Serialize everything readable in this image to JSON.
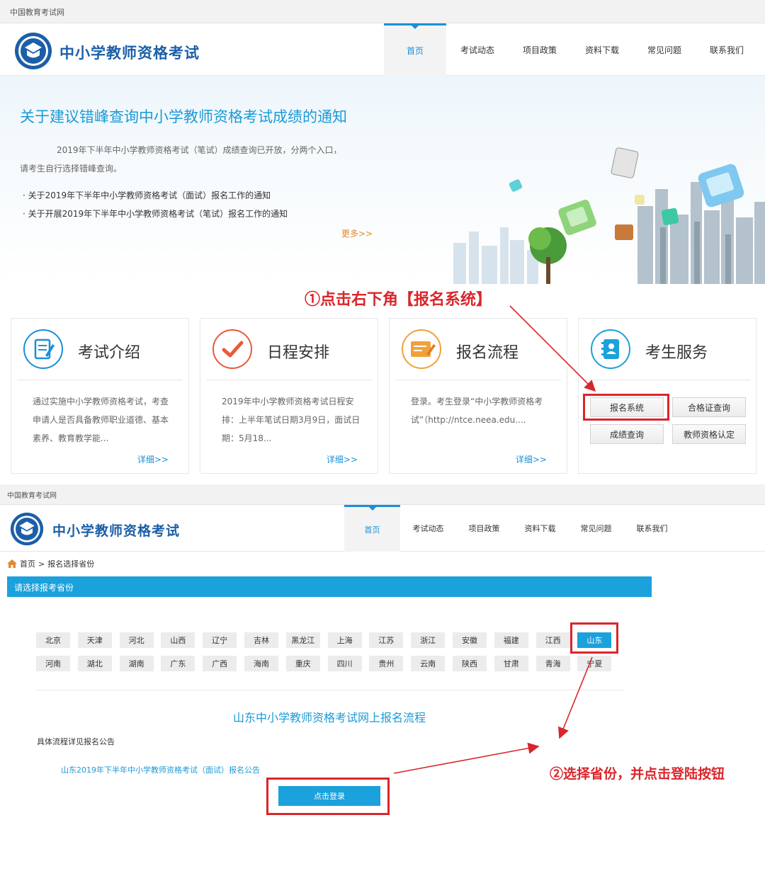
{
  "top": {
    "topbar_text": "中国教育考试网",
    "site_title": "中小学教师资格考试",
    "nav": [
      "首页",
      "考试动态",
      "项目政策",
      "资料下载",
      "常见问题",
      "联系我们"
    ],
    "banner": {
      "title": "关于建议错峰查询中小学教师资格考试成绩的通知",
      "para1": "2019年下半年中小学教师资格考试（笔试）成绩查询已开放，分两个入口，",
      "para2": "请考生自行选择错峰查询。",
      "links": [
        "关于2019年下半年中小学教师资格考试（面试）报名工作的通知",
        "关于开展2019年下半年中小学教师资格考试（笔试）报名工作的通知"
      ],
      "more": "更多>>"
    },
    "annotation": "①点击右下角【报名系统】",
    "cards": [
      {
        "title": "考试介绍",
        "body": "通过实施中小学教师资格考试，考查申请人是否具备教师职业道德、基本素养、教育教学能...",
        "more": "详细>>"
      },
      {
        "title": "日程安排",
        "body": "2019年中小学教师资格考试日程安排：上半年笔试日期3月9日，面试日期：5月18...",
        "more": "详细>>"
      },
      {
        "title": "报名流程",
        "body": "登录。考生登录“中小学教师资格考试”（http://ntce.neea.edu....",
        "more": "详细>>"
      },
      {
        "title": "考生服务",
        "buttons": [
          "报名系统",
          "合格证查询",
          "成绩查询",
          "教师资格认定"
        ]
      }
    ]
  },
  "bottom": {
    "topbar_text": "中国教育考试网",
    "site_title": "中小学教师资格考试",
    "nav": [
      "首页",
      "考试动态",
      "项目政策",
      "资料下载",
      "常见问题",
      "联系我们"
    ],
    "breadcrumb": {
      "home": "首页",
      "sep": ">",
      "current": "报名选择省份"
    },
    "section_title": "请选择报考省份",
    "provinces_row1": [
      "北京",
      "天津",
      "河北",
      "山西",
      "辽宁",
      "吉林",
      "黑龙江",
      "上海",
      "江苏",
      "浙江",
      "安徽",
      "福建",
      "江西",
      "山东"
    ],
    "provinces_row2": [
      "河南",
      "湖北",
      "湖南",
      "广东",
      "广西",
      "海南",
      "重庆",
      "四川",
      "贵州",
      "云南",
      "陕西",
      "甘肃",
      "青海",
      "宁夏"
    ],
    "selected_province": "山东",
    "process_title": "山东中小学教师资格考试网上报名流程",
    "process_sub": "具体流程详见报名公告",
    "announcement_link": "山东2019年下半年中小学教师资格考试（面试）报名公告",
    "login_button": "点击登录",
    "annotation": "②选择省份，并点击登陆按钮"
  },
  "colors": {
    "accent_blue": "#1ba1db",
    "brand_blue": "#1b5fa8",
    "annotation_red": "#d9262b",
    "more_orange": "#e2892b"
  }
}
